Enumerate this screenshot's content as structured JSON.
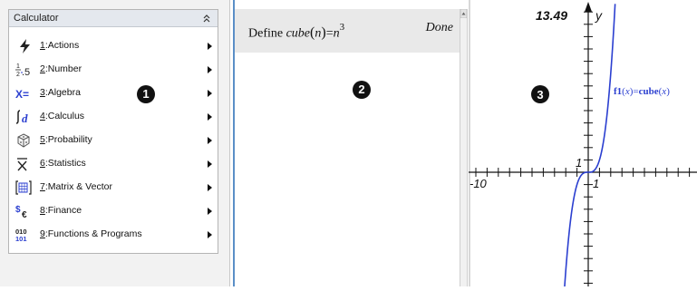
{
  "menu": {
    "title": "Calculator",
    "items": [
      {
        "num": "1",
        "label": ":Actions",
        "icon": "lightning-icon"
      },
      {
        "num": "2",
        "label": ":Number",
        "icon": "fraction-decimal-icon"
      },
      {
        "num": "3",
        "label": ":Algebra",
        "icon": "x-equals-icon"
      },
      {
        "num": "4",
        "label": ":Calculus",
        "icon": "integral-d-icon"
      },
      {
        "num": "5",
        "label": ":Probability",
        "icon": "dice-icon"
      },
      {
        "num": "6",
        "label": ":Statistics",
        "icon": "x-bar-icon"
      },
      {
        "num": "7",
        "label": ":Matrix & Vector",
        "icon": "matrix-icon"
      },
      {
        "num": "8",
        "label": ":Finance",
        "icon": "dollar-euro-icon"
      },
      {
        "num": "9",
        "label": ":Functions & Programs",
        "icon": "binary-icon"
      }
    ],
    "icon_glyphs": {
      "number_decimal": ".5",
      "algebra": "X=",
      "calculus": "d",
      "binary_top": "010",
      "binary_bottom": "101"
    }
  },
  "callouts": {
    "one": "1",
    "two": "2",
    "three": "3"
  },
  "calculator": {
    "prefix": "Define ",
    "fname": "cube",
    "arg": "n",
    "rhs_var": "n",
    "exponent": "3",
    "result": "Done"
  },
  "graph": {
    "ymax_label": "13.49",
    "y_axis_label": "y",
    "x_min_label": "-10",
    "x_tick_label": "1",
    "y_tick_label": "1",
    "function_label": {
      "name": "f1",
      "var": "x",
      "eq": "=",
      "fn": "cube",
      "arg": "x"
    }
  },
  "colors": {
    "accent": "#5b8fc7",
    "curve": "#2b3fd0",
    "entry_bg": "#e9e9e9"
  }
}
